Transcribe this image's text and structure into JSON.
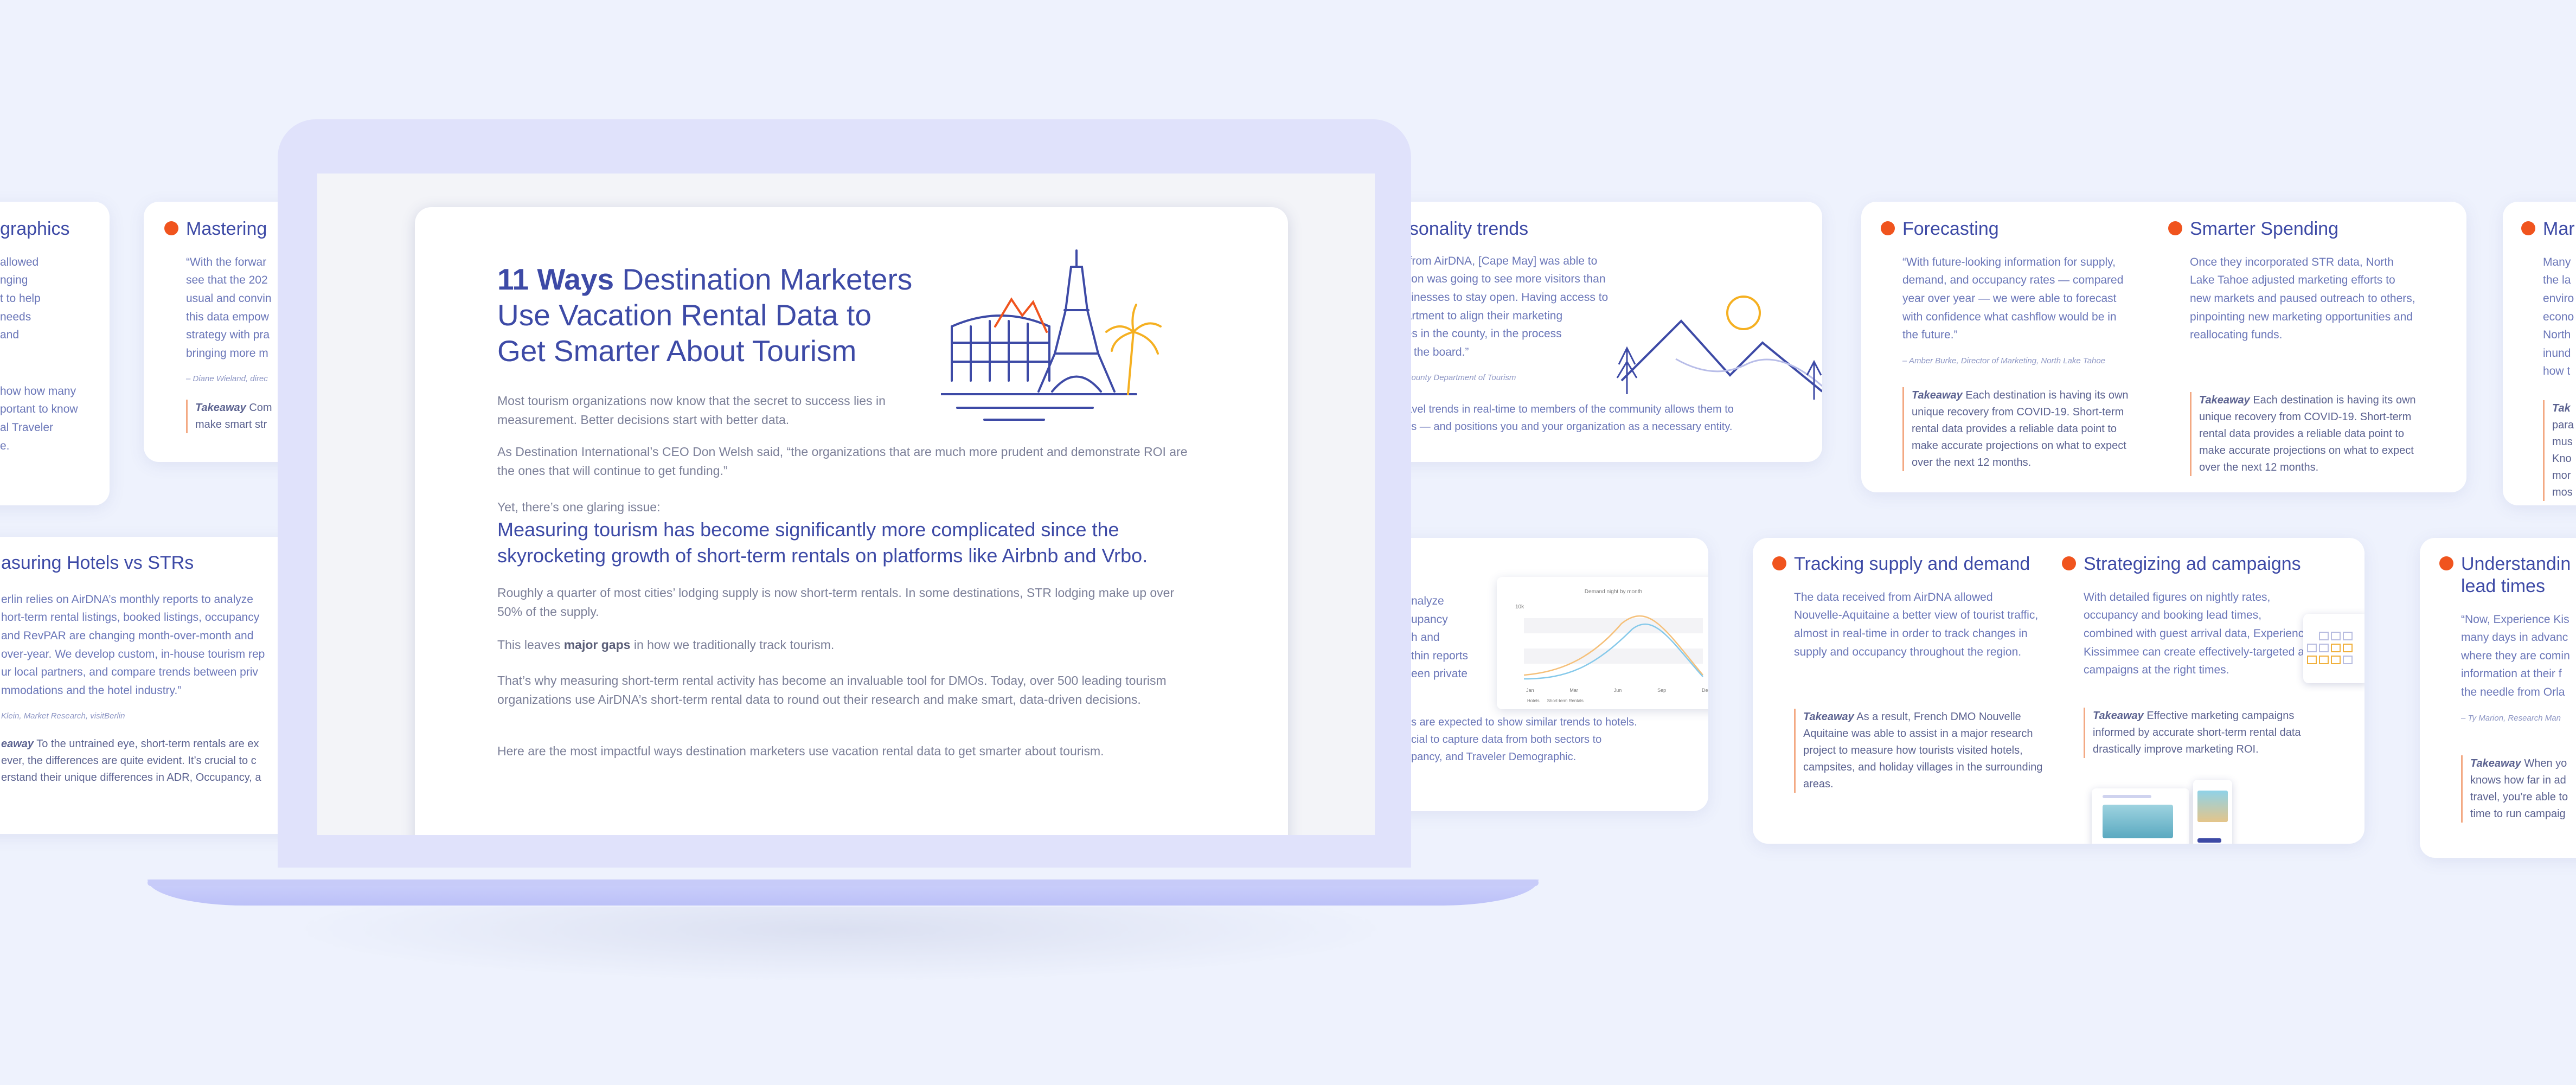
{
  "doc": {
    "title_strong_1": "11 Ways",
    "title_rest_1": " Destination Marketers",
    "title_line_2": "Use Vacation Rental Data to",
    "title_strong_3": "Get Smarter About Tourism",
    "p1": "Most tourism organizations now know that the secret to success lies in measurement. Better decisions start with better data.",
    "p2": "As Destination International’s CEO Don Welsh said, “the organizations that are much more prudent and demonstrate ROI are the ones that will continue to get funding.”",
    "p3_lead": "Yet, there’s one glaring issue:",
    "p3_emph": "Measuring tourism has become significantly more complicated since the skyrocketing growth of short-term rentals on platforms like Airbnb and Vrbo.",
    "p4": "Roughly a quarter of most cities’ lodging supply is now short-term rentals. In some destinations, STR lodging make up over 50% of the supply.",
    "p5_pre": "This leaves ",
    "p5_bold": "major gaps",
    "p5_post": " in how we traditionally track tourism.",
    "p6": "That’s why measuring short-term rental activity has become an invaluable tool for DMOs. Today, over 500 leading tourism organizations use AirDNA’s short-term rental data to round out their research and make smart, data-driven decisions.",
    "p7": "Here are the most impactful ways destination marketers use vacation rental data to get smarter about tourism."
  },
  "cards": {
    "demographics": {
      "title": "graphics",
      "body": "allowed\nnging\nt to help\nneeds\nand",
      "take": "how how many\nportant to know\nal Traveler\ne."
    },
    "mastering": {
      "title": "Mastering",
      "quote": "“With the forwar\nsee that the 202\nusual and convin\nthis data empow\nstrategy with pra\nbringing more m",
      "attr": "– Diane Wieland, direc",
      "take_label": "Takeaway",
      "take": " Com\nmake smart str"
    },
    "hotels": {
      "title": "asuring Hotels vs STRs",
      "body": "erlin relies on AirDNA’s monthly reports to analyze\nhort-term rental listings, booked listings, occupancy\nand RevPAR are changing month-over-month and\nover-year. We develop custom, in-house tourism rep\nur local partners, and compare trends between priv\nmmodations and the hotel industry.”",
      "attr": "Klein, Market Research, visitBerlin",
      "take_label": "eaway",
      "take": " To the untrained eye, short-term rentals are ex\never, the differences are quite evident. It’s crucial to c\nerstand their unique differences in ADR, Occupancy, a"
    },
    "seasonality": {
      "title": "asonality trends",
      "quote": "a from AirDNA, [Cape May] was able to\nason was going to see more visitors than\nusinesses to stay open. Having access to\npartment to align their marketing\nges in the county, in the process\nss the board.”",
      "attr": "y County Department of Tourism",
      "take": "travel trends in real-time to members of the community allows them to\nons — and positions you and your organization as a necessary entity."
    },
    "analyze": {
      "body": "nalyze\nupancy\nh and\nthin reports\neen private",
      "take": "s are expected to show similar trends to hotels.\ncial to capture data from both sectors to\npancy, and Traveler Demographic."
    },
    "mini_chart": {
      "title": "Demand night by month",
      "y_tick": "10k",
      "x_ticks": [
        "Jan",
        "Mar",
        "Jun",
        "Sep",
        "Dec"
      ],
      "legend_a": "Hotels",
      "legend_b": "Short-term Rentals"
    },
    "forecasting": {
      "title": "Forecasting",
      "quote": "“With future-looking information for supply, demand, and occupancy rates — compared year over year — we were able to forecast with confidence what cashflow would be in the future.”",
      "attr": "– Amber Burke, Director of Marketing, North Lake Tahoe",
      "take_label": "Takeaway",
      "take": " Each destination is having its own unique recovery from COVID-19. Short-term rental data provides a reliable data point to make accurate projections on what to expect over the next 12 months."
    },
    "spending": {
      "title": "Smarter Spending",
      "body": "Once they incorporated STR data, North Lake Tahoe adjusted marketing efforts to new markets and paused outreach to others, pinpointing new marketing opportunities and reallocating funds.",
      "take_label": "Takeaway",
      "take": " Each destination is having its own unique recovery from COVID-19. Short-term rental data provides a reliable data point to make accurate projections on what to expect over the next 12 months."
    },
    "mar": {
      "title": "Mar",
      "body": "Many\nthe la\nenviro\necono\nNorth\ninund\nhow t",
      "take_label": "Tak",
      "take": "\npara\nmus\nKno\nmor\nmos"
    },
    "supply": {
      "title": "Tracking supply and demand",
      "body": "The data received from AirDNA allowed Nouvelle-Aquitaine a better view of tourist traffic, almost in real-time in order to track changes in supply and occupancy throughout the region.",
      "take_label": "Takeaway",
      "take": " As a result, French DMO Nouvelle Aquitaine was able to assist in a major research project to measure how tourists visited hotels, campsites, and holiday villages in the surrounding areas."
    },
    "ads": {
      "title": "Strategizing ad campaigns",
      "body": "With detailed figures on nightly rates, occupancy and booking lead times, combined with guest arrival data, Experience Kissimmee can create effectively-targeted ad campaigns at the right times.",
      "take_label": "Takeaway",
      "take": " Effective marketing campaigns informed by accurate short-term rental data drastically improve marketing ROI."
    },
    "lead": {
      "title": "Understandin\nlead times",
      "quote": "“Now, Experience Kis\nmany days in advanc\nwhere they are comin\ninformation at their f\nthe needle from Orla",
      "attr": "– Ty Marion, Research Man",
      "take_label": "Takeaway",
      "take": " When yo\nknows how far in ad\ntravel, you’re able to\ntime to run campaig"
    }
  },
  "colors": {
    "accent": "#f0541e",
    "navy": "#3d4aa6",
    "background": "#eef2fd"
  }
}
